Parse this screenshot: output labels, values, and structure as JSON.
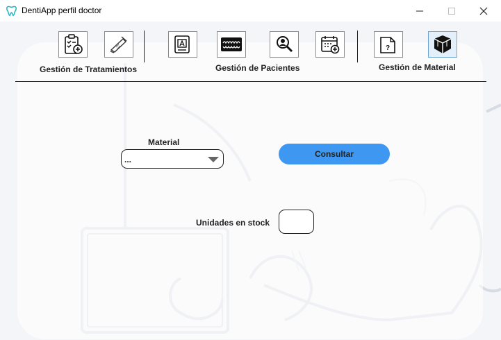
{
  "window": {
    "title": "DentiApp perfil doctor",
    "app_icon": "tooth-icon",
    "controls": [
      "minimize-icon",
      "maximize-icon",
      "close-icon"
    ]
  },
  "toolbar": {
    "sections": [
      {
        "label": "Gestión de Tratamientos",
        "buttons": [
          "clipboard-checklist-icon",
          "dental-tools-icon"
        ]
      },
      {
        "label": "Gestión de Pacientes",
        "buttons": [
          "patient-record-icon",
          "dental-xray-icon",
          "search-patient-icon",
          "calendar-add-icon"
        ]
      },
      {
        "label": "Gestión de Material",
        "buttons": [
          "folder-question-icon",
          "stock-boxes-icon"
        ]
      }
    ],
    "active_section": "Gestión de Material"
  },
  "form": {
    "material_label": "Material",
    "material_value": "...",
    "consult_label": "Consultar",
    "stock_label": "Unidades en stock",
    "stock_value": ""
  },
  "colors": {
    "accent": "#3e97f0",
    "background": "#f4f5f8",
    "icon_teal": "#27b4c4"
  }
}
